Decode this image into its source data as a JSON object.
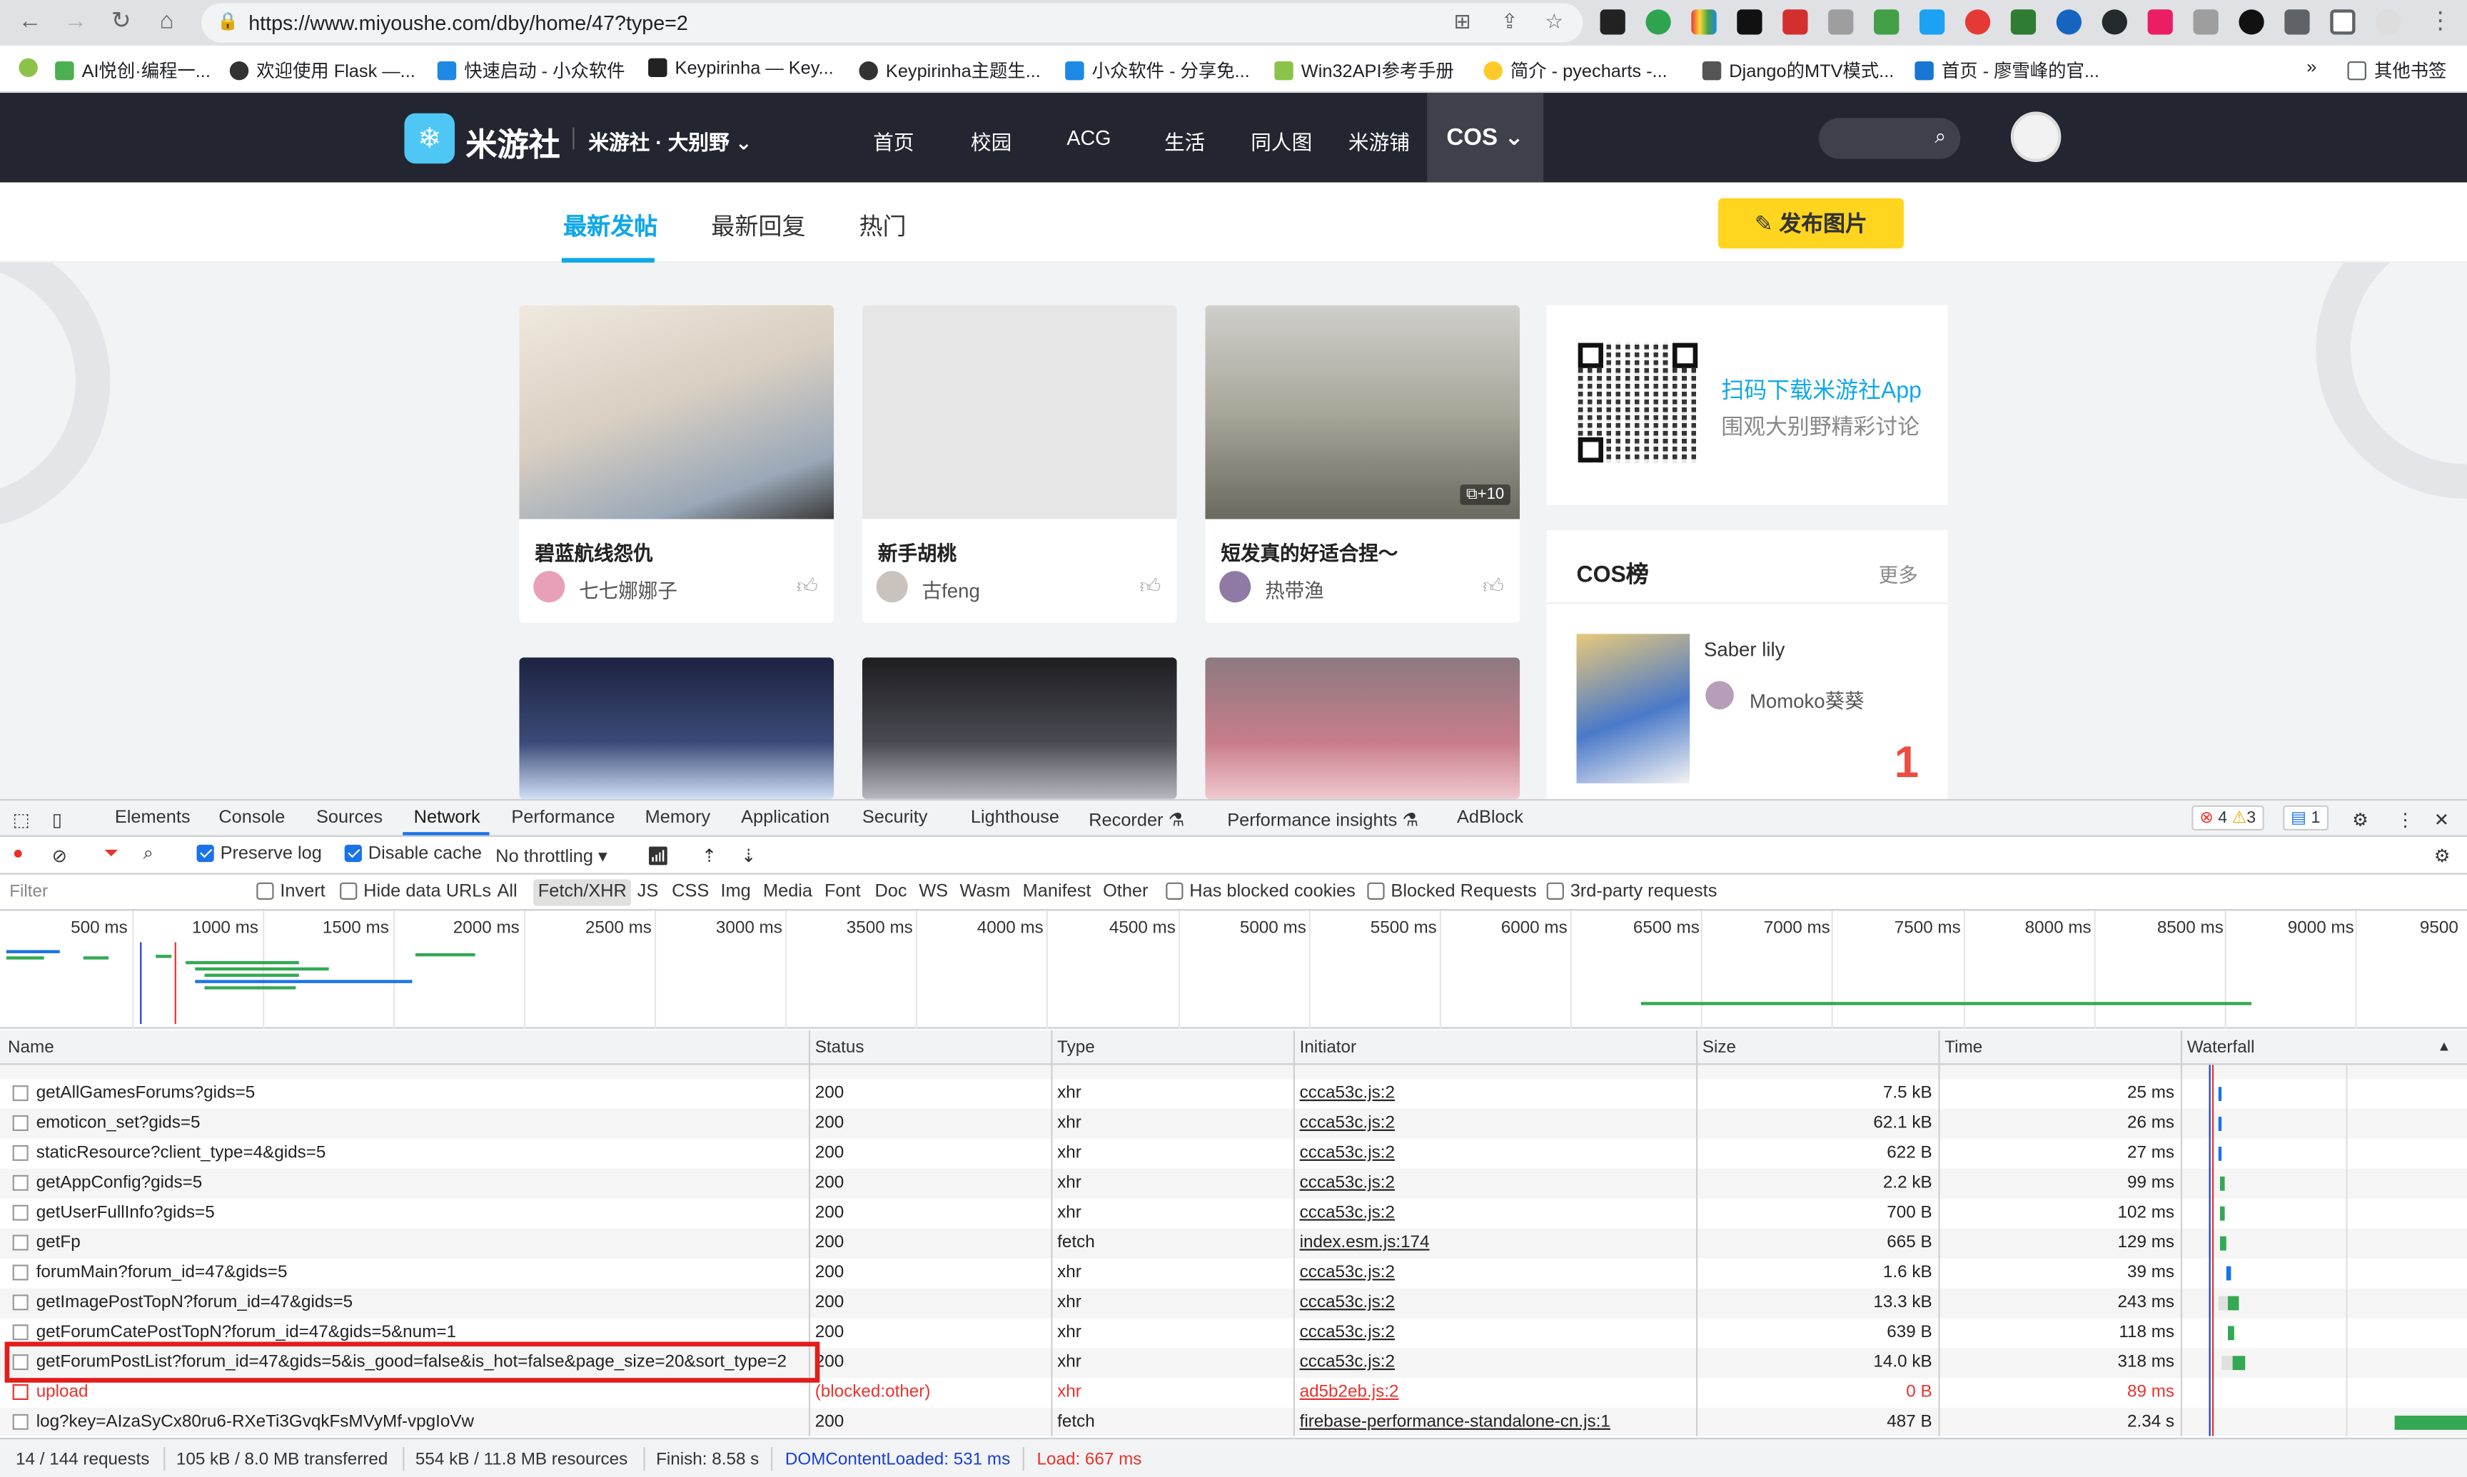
{
  "browser": {
    "url": "https://www.miyoushe.com/dby/home/47?type=2",
    "bookmarks": [
      {
        "label": "AI悦创·编程一...",
        "color": "#4caf50"
      },
      {
        "label": "欢迎使用 Flask —...",
        "color": "#333333"
      },
      {
        "label": "快速启动 - 小众软件",
        "color": "#1e88e5"
      },
      {
        "label": "Keypirinha — Key...",
        "color": "#222222"
      },
      {
        "label": "Keypirinha主题生...",
        "color": "#333333"
      },
      {
        "label": "小众软件 - 分享免...",
        "color": "#1e88e5"
      },
      {
        "label": "Win32API参考手册",
        "color": "#8bc34a"
      },
      {
        "label": "简介 - pyecharts -...",
        "color": "#ffca28"
      },
      {
        "label": "Django的MTV模式...",
        "color": "#555555"
      },
      {
        "label": "首页 - 廖雪峰的官...",
        "color": "#1976d2"
      }
    ],
    "other_bookmarks": "其他书签"
  },
  "site": {
    "logo_icon": "❄",
    "logo_text": "米游社",
    "forum_selector": "米游社 · 大别野",
    "nav": [
      "首页",
      "校园",
      "ACG",
      "生活",
      "同人图",
      "米游铺"
    ],
    "nav_active": "COS",
    "subtabs": [
      "最新发帖",
      "最新回复",
      "热门"
    ],
    "publish_label": "发布图片",
    "posts": [
      {
        "title": "碧蓝航线怨仇",
        "author": "七七娜娜子",
        "img_color": "#d8d2c8",
        "avatar_color": "#e8a0b8"
      },
      {
        "title": "新手胡桃",
        "author": "古feng",
        "img_color": "#e6e6e6",
        "avatar_color": "#c9c2bd"
      },
      {
        "title": "短发真的好适合捏～",
        "author": "热带渔",
        "img_color": "#a9a69a",
        "avatar_color": "#8e7aa5",
        "badge": "+10"
      }
    ],
    "posts_row2_colors": [
      "#3b4a78",
      "#4a4a52",
      "#c87d8b"
    ],
    "qr_title": "扫码下载米游社App",
    "qr_subtitle": "围观大别野精彩讨论",
    "rank_title": "COS榜",
    "rank_more": "更多",
    "rank_item": {
      "name": "Saber lily",
      "author": "Momoko葵葵",
      "number": "1"
    }
  },
  "devtools": {
    "tabs": [
      "Elements",
      "Console",
      "Sources",
      "Network",
      "Performance",
      "Memory",
      "Application",
      "Security",
      "Lighthouse",
      "Recorder",
      "Performance insights",
      "AdBlock"
    ],
    "active_tab": "Network",
    "errors": "4",
    "warnings": "3",
    "messages": "1",
    "toolbar": {
      "preserve_log": "Preserve log",
      "disable_cache": "Disable cache",
      "throttling": "No throttling"
    },
    "filter": {
      "placeholder": "Filter",
      "invert": "Invert",
      "hide_data_urls": "Hide data URLs",
      "types": [
        "All",
        "Fetch/XHR",
        "JS",
        "CSS",
        "Img",
        "Media",
        "Font",
        "Doc",
        "WS",
        "Wasm",
        "Manifest",
        "Other"
      ],
      "selected_type": "Fetch/XHR",
      "has_blocked_cookies": "Has blocked cookies",
      "blocked_requests": "Blocked Requests",
      "third_party": "3rd-party requests"
    },
    "timeline_ticks": [
      "500 ms",
      "1000 ms",
      "1500 ms",
      "2000 ms",
      "2500 ms",
      "3000 ms",
      "3500 ms",
      "4000 ms",
      "4500 ms",
      "5000 ms",
      "5500 ms",
      "6000 ms",
      "6500 ms",
      "7000 ms",
      "7500 ms",
      "8000 ms",
      "8500 ms",
      "9000 ms",
      "9500"
    ],
    "columns": [
      "Name",
      "Status",
      "Type",
      "Initiator",
      "Size",
      "Time",
      "Waterfall"
    ],
    "rows": [
      {
        "name": "getAllGamesForums?gids=5",
        "status": "200",
        "type": "xhr",
        "initiator": "ccca53c.js:2",
        "size": "7.5 kB",
        "time": "25 ms"
      },
      {
        "name": "emoticon_set?gids=5",
        "status": "200",
        "type": "xhr",
        "initiator": "ccca53c.js:2",
        "size": "62.1 kB",
        "time": "26 ms"
      },
      {
        "name": "staticResource?client_type=4&gids=5",
        "status": "200",
        "type": "xhr",
        "initiator": "ccca53c.js:2",
        "size": "622 B",
        "time": "27 ms"
      },
      {
        "name": "getAppConfig?gids=5",
        "status": "200",
        "type": "xhr",
        "initiator": "ccca53c.js:2",
        "size": "2.2 kB",
        "time": "99 ms"
      },
      {
        "name": "getUserFullInfo?gids=5",
        "status": "200",
        "type": "xhr",
        "initiator": "ccca53c.js:2",
        "size": "700 B",
        "time": "102 ms"
      },
      {
        "name": "getFp",
        "status": "200",
        "type": "fetch",
        "initiator": "index.esm.js:174",
        "size": "665 B",
        "time": "129 ms"
      },
      {
        "name": "forumMain?forum_id=47&gids=5",
        "status": "200",
        "type": "xhr",
        "initiator": "ccca53c.js:2",
        "size": "1.6 kB",
        "time": "39 ms"
      },
      {
        "name": "getImagePostTopN?forum_id=47&gids=5",
        "status": "200",
        "type": "xhr",
        "initiator": "ccca53c.js:2",
        "size": "13.3 kB",
        "time": "243 ms"
      },
      {
        "name": "getForumCatePostTopN?forum_id=47&gids=5&num=1",
        "status": "200",
        "type": "xhr",
        "initiator": "ccca53c.js:2",
        "size": "639 B",
        "time": "118 ms"
      },
      {
        "name": "getForumPostList?forum_id=47&gids=5&is_good=false&is_hot=false&page_size=20&sort_type=2",
        "status": "200",
        "type": "xhr",
        "initiator": "ccca53c.js:2",
        "size": "14.0 kB",
        "time": "318 ms"
      },
      {
        "name": "upload",
        "status": "(blocked:other)",
        "type": "xhr",
        "initiator": "ad5b2eb.js:2",
        "size": "0 B",
        "time": "89 ms",
        "error": true
      },
      {
        "name": "log?key=AIzaSyCx80ru6-RXeTi3GvqkFsMVyMf-vpgIoVw",
        "status": "200",
        "type": "fetch",
        "initiator": "firebase-performance-standalone-cn.js:1",
        "size": "487 B",
        "time": "2.34 s"
      }
    ],
    "status_bar": {
      "requests": "14 / 144 requests",
      "transferred": "105 kB / 8.0 MB transferred",
      "resources": "554 kB / 11.8 MB resources",
      "finish": "Finish: 8.58 s",
      "dom_loaded": "DOMContentLoaded: 531 ms",
      "load": "Load: 667 ms"
    }
  }
}
